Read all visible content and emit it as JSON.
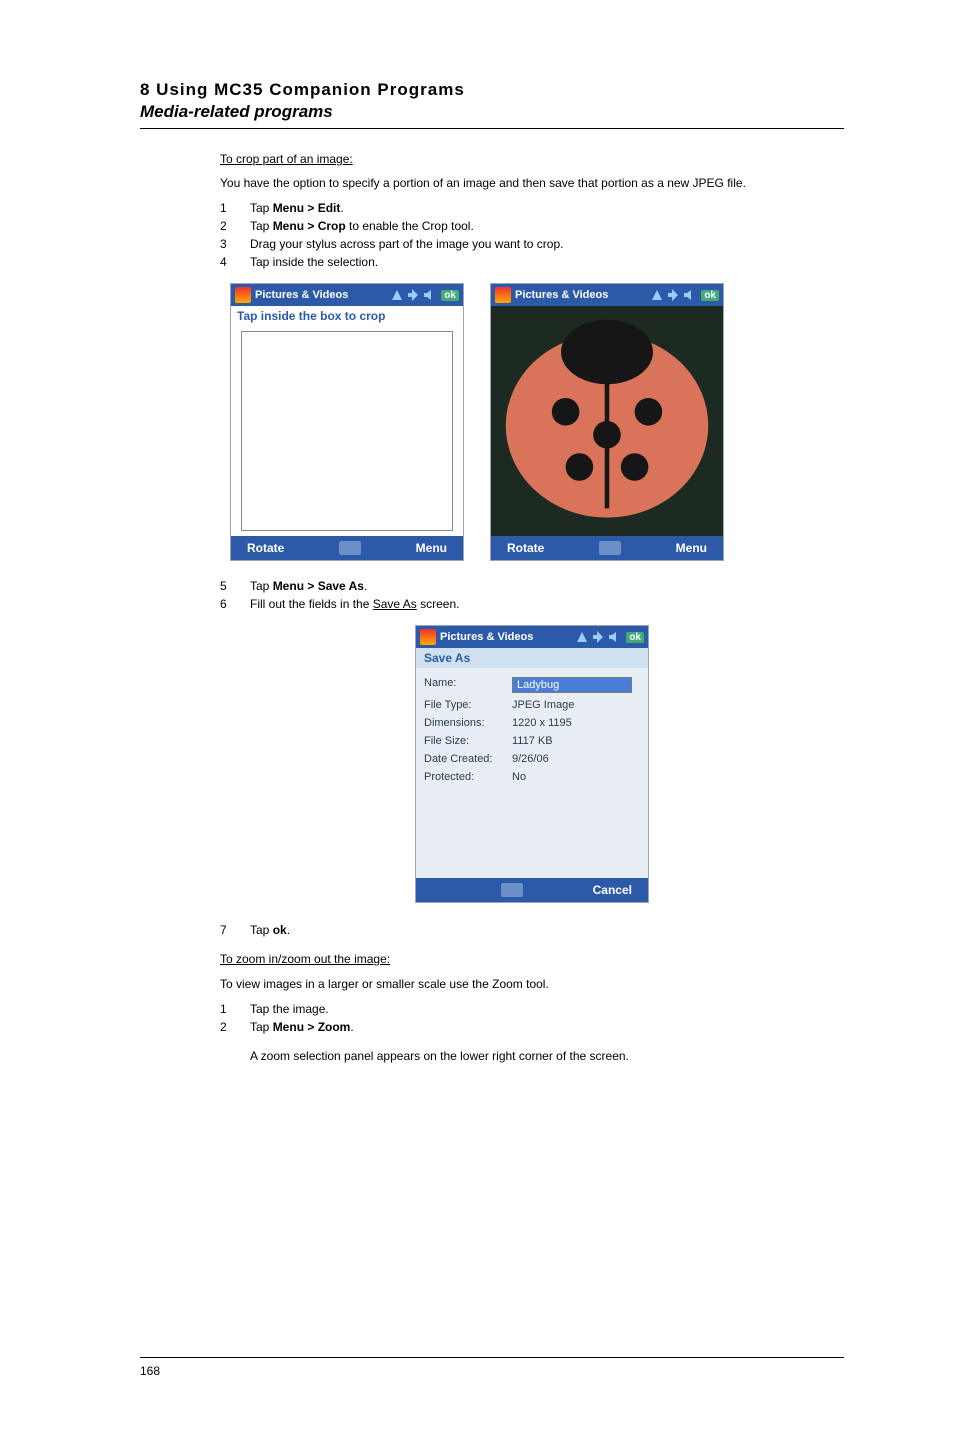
{
  "header": {
    "chapter": "8 Using MC35 Companion Programs",
    "section": "Media-related programs"
  },
  "crop": {
    "heading": "To crop part of an image:",
    "intro": "You have the option to specify a portion of an image and then save that portion as a new JPEG file.",
    "steps": [
      {
        "num": "1",
        "pre": "Tap ",
        "bold": "Menu > Edit",
        "post": "."
      },
      {
        "num": "2",
        "pre": "Tap ",
        "bold": "Menu > Crop",
        "post": " to enable the Crop tool."
      },
      {
        "num": "3",
        "pre": "Drag your stylus across part of the image you want to crop.",
        "bold": "",
        "post": ""
      },
      {
        "num": "4",
        "pre": "Tap inside the selection.",
        "bold": "",
        "post": ""
      }
    ],
    "steps2": [
      {
        "num": "5",
        "pre": "Tap ",
        "bold": "Menu > Save As",
        "post": "."
      },
      {
        "num": "6",
        "pre": "Fill out the fields in the ",
        "under": "Save As",
        "post": " screen."
      }
    ],
    "steps3": [
      {
        "num": "7",
        "pre": "Tap ",
        "bold": "ok",
        "post": "."
      }
    ]
  },
  "zoom": {
    "heading": "To zoom in/zoom out the image:",
    "intro": "To view images in a larger or smaller scale use the Zoom tool.",
    "steps": [
      {
        "num": "1",
        "pre": "Tap the image.",
        "bold": "",
        "post": ""
      },
      {
        "num": "2",
        "pre": "Tap ",
        "bold": "Menu > Zoom",
        "post": "."
      }
    ],
    "note": "A zoom selection panel appears on the lower right corner of the screen."
  },
  "phone": {
    "app_title": "Pictures & Videos",
    "ok": "ok",
    "crop_hint": "Tap inside the box to crop",
    "rotate": "Rotate",
    "menu": "Menu",
    "cancel": "Cancel"
  },
  "saveas": {
    "title": "Save As",
    "name_label": "Name:",
    "name_value": "Ladybug",
    "filetype_label": "File Type:",
    "filetype_value": "JPEG Image",
    "dimensions_label": "Dimensions:",
    "dimensions_value": "1220 x 1195",
    "filesize_label": "File Size:",
    "filesize_value": "1117 KB",
    "date_label": "Date Created:",
    "date_value": "9/26/06",
    "protected_label": "Protected:",
    "protected_value": "No"
  },
  "page_number": "168"
}
